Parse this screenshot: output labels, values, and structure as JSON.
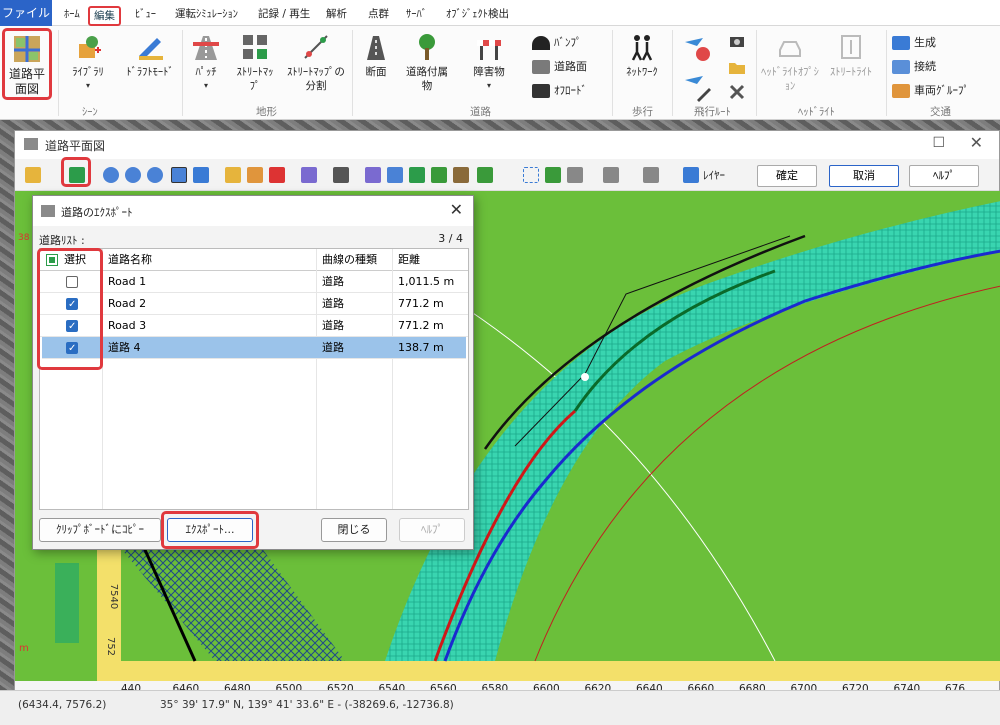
{
  "tabs": {
    "file": "ファイル",
    "home": "ﾎｰﾑ",
    "edit": "編集",
    "view": "ﾋﾞｭｰ",
    "sim": "運転ｼﾐｭﾚｰｼｮﾝ",
    "record": "記録 / 再生",
    "analysis": "解析",
    "inspect": "点群",
    "server": "ｻｰﾊﾞ",
    "object": "ｵﾌﾞｼﾞｪｸﾄ検出"
  },
  "ribbon": {
    "road_plan": "道路平面図",
    "library": "ﾗｲﾌﾞﾗﾘ",
    "draft_mode": "ﾄﾞﾗﾌﾄﾓｰﾄﾞ",
    "patch": "ﾊﾟｯﾁ",
    "street_map": "ｽﾄﾘｰﾄﾏｯﾌﾟ",
    "split_street_map": "ｽﾄﾘｰﾄﾏｯﾌﾟの分割",
    "section": "断面",
    "road_accessory": "道路付属物",
    "obstacle": "障害物",
    "bump": "ﾊﾞﾝﾌﾟ",
    "road_surface": "道路面",
    "offroad": "ｵﾌﾛｰﾄﾞ",
    "network": "ﾈｯﾄﾜｰｸ",
    "headlight_option": "ﾍｯﾄﾞﾗｲﾄｵﾌﾟｼｮﾝ",
    "street_light": "ｽﾄﾘｰﾄﾗｲﾄ",
    "generate": "生成",
    "connect": "接続",
    "vehicle_group": "車両ｸﾞﾙｰﾌﾟ",
    "groups": {
      "scene": "ｼｰﾝ",
      "terrain": "地形",
      "road": "道路",
      "walk": "歩行",
      "flight_route": "飛行ﾙｰﾄ",
      "headlight": "ﾍｯﾄﾞﾗｲﾄ",
      "traffic": "交通"
    }
  },
  "plan_window": {
    "title": "道路平面図",
    "layers": "ﾚｲﾔｰ",
    "confirm": "確定",
    "cancel": "取消",
    "help": "ﾍﾙﾌﾟ",
    "x_ticks": [
      "440",
      "6460",
      "6480",
      "6500",
      "6520",
      "6540",
      "6560",
      "6580",
      "6600",
      "6620",
      "6640",
      "6660",
      "6680",
      "6700",
      "6720",
      "6740",
      "676"
    ],
    "y_ticks": [
      "7540",
      "752"
    ],
    "left_tick": "38",
    "left_unit": "m"
  },
  "dialog": {
    "title": "道路のｴｸｽﾎﾟｰﾄ",
    "list_label": "道路ﾘｽﾄ :",
    "count": "3 / 4",
    "columns": {
      "select": "選択",
      "name": "道路名称",
      "curve": "曲線の種類",
      "distance": "距離"
    },
    "rows": [
      {
        "name": "Road 1",
        "curve": "道路",
        "distance": "1,011.5 m",
        "checked": false,
        "selected": false
      },
      {
        "name": "Road 2",
        "curve": "道路",
        "distance": "771.2 m",
        "checked": true,
        "selected": false
      },
      {
        "name": "Road 3",
        "curve": "道路",
        "distance": "771.2 m",
        "checked": true,
        "selected": false
      },
      {
        "name": "道路 4",
        "curve": "道路",
        "distance": "138.7 m",
        "checked": true,
        "selected": true
      }
    ],
    "copy_clipboard": "ｸﾘｯﾌﾟﾎﾞｰﾄﾞにｺﾋﾟｰ",
    "export": "ｴｸｽﾎﾟｰﾄ...",
    "close": "閉じる",
    "help": "ﾍﾙﾌﾟ"
  },
  "status": {
    "local": "(6434.4, 7576.2)",
    "geo": "35° 39' 17.9\" N, 139° 41' 33.6\" E  -  (-38269.6, -12736.8)"
  },
  "colors": {
    "accent": "#2b64c8",
    "highlight": "#e0393e",
    "canvas": "#6bbf3a",
    "road_band": "#39d5b0",
    "selected_row": "#9bc3ea"
  }
}
